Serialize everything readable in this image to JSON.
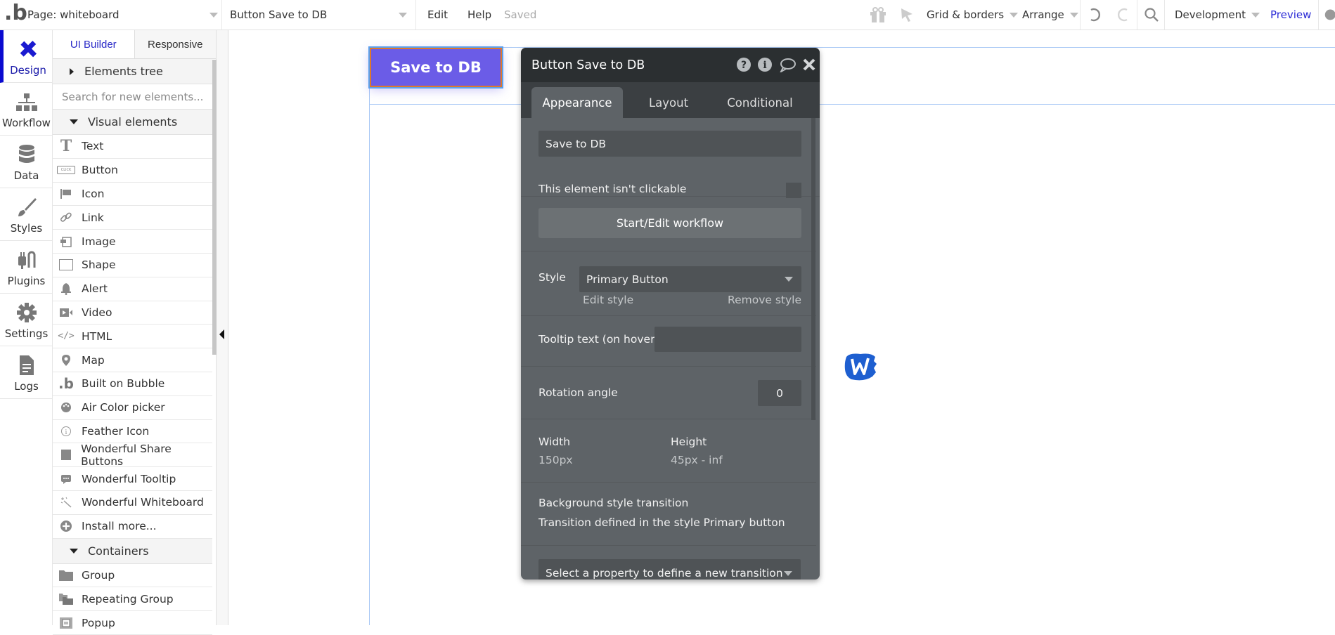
{
  "topbar": {
    "page_select": "Page: whiteboard",
    "element_select": "Button Save to DB",
    "menu": [
      "Edit",
      "Help"
    ],
    "save_status": "Saved",
    "grid_borders": "Grid & borders",
    "arrange": "Arrange",
    "environment": "Development",
    "preview": "Preview"
  },
  "rail": {
    "items": [
      {
        "label": "Design",
        "icon": "design-icon",
        "active": true
      },
      {
        "label": "Workflow",
        "icon": "workflow-icon"
      },
      {
        "label": "Data",
        "icon": "database-icon"
      },
      {
        "label": "Styles",
        "icon": "brush-icon"
      },
      {
        "label": "Plugins",
        "icon": "plug-icon"
      },
      {
        "label": "Settings",
        "icon": "gear-icon"
      },
      {
        "label": "Logs",
        "icon": "document-icon"
      }
    ]
  },
  "elements_panel": {
    "tabs": [
      "UI Builder",
      "Responsive"
    ],
    "elements_tree": "Elements tree",
    "search_placeholder": "Search for new elements...",
    "visual_section": "Visual elements",
    "visual_items": [
      {
        "label": "Text",
        "icon": "text-icon"
      },
      {
        "label": "Button",
        "icon": "button-icon"
      },
      {
        "label": "Icon",
        "icon": "flag-icon"
      },
      {
        "label": "Link",
        "icon": "link-icon"
      },
      {
        "label": "Image",
        "icon": "image-icon"
      },
      {
        "label": "Shape",
        "icon": "shape-icon"
      },
      {
        "label": "Alert",
        "icon": "bell-icon"
      },
      {
        "label": "Video",
        "icon": "video-icon"
      },
      {
        "label": "HTML",
        "icon": "code-icon"
      },
      {
        "label": "Map",
        "icon": "map-pin-icon"
      },
      {
        "label": "Built on Bubble",
        "icon": "bubble-logo-icon"
      },
      {
        "label": "Air Color picker",
        "icon": "palette-icon"
      },
      {
        "label": "Feather Icon",
        "icon": "info-circle-icon"
      },
      {
        "label": "Wonderful Share Buttons",
        "icon": "square-icon"
      },
      {
        "label": "Wonderful Tooltip",
        "icon": "chat-bubble-icon"
      },
      {
        "label": "Wonderful Whiteboard",
        "icon": "magic-wand-icon"
      },
      {
        "label": "Install more...",
        "icon": "plus-circle-icon"
      }
    ],
    "containers_section": "Containers",
    "container_items": [
      {
        "label": "Group",
        "icon": "folder-icon"
      },
      {
        "label": "Repeating Group",
        "icon": "folders-icon"
      },
      {
        "label": "Popup",
        "icon": "popup-icon"
      }
    ]
  },
  "canvas": {
    "button_label": "Save to DB",
    "button_color": "#6b5ce7"
  },
  "property_editor": {
    "title": "Button Save to DB",
    "tabs": [
      "Appearance",
      "Layout",
      "Conditional"
    ],
    "active_tab": "Appearance",
    "button_text": "Save to DB",
    "not_clickable_label": "This element isn't clickable",
    "not_clickable_checked": false,
    "workflow_button": "Start/Edit workflow",
    "style_label": "Style",
    "style_value": "Primary Button",
    "edit_style": "Edit style",
    "remove_style": "Remove style",
    "tooltip_label": "Tooltip text (on hover)",
    "tooltip_value": "",
    "rotation_label": "Rotation angle",
    "rotation_value": "0",
    "width_label": "Width",
    "width_value": "150px",
    "height_label": "Height",
    "height_value": "45px - inf",
    "transition_title": "Background style transition",
    "transition_desc": "Transition defined in the style Primary button",
    "transition_select": "Select a property to define a new transition"
  }
}
